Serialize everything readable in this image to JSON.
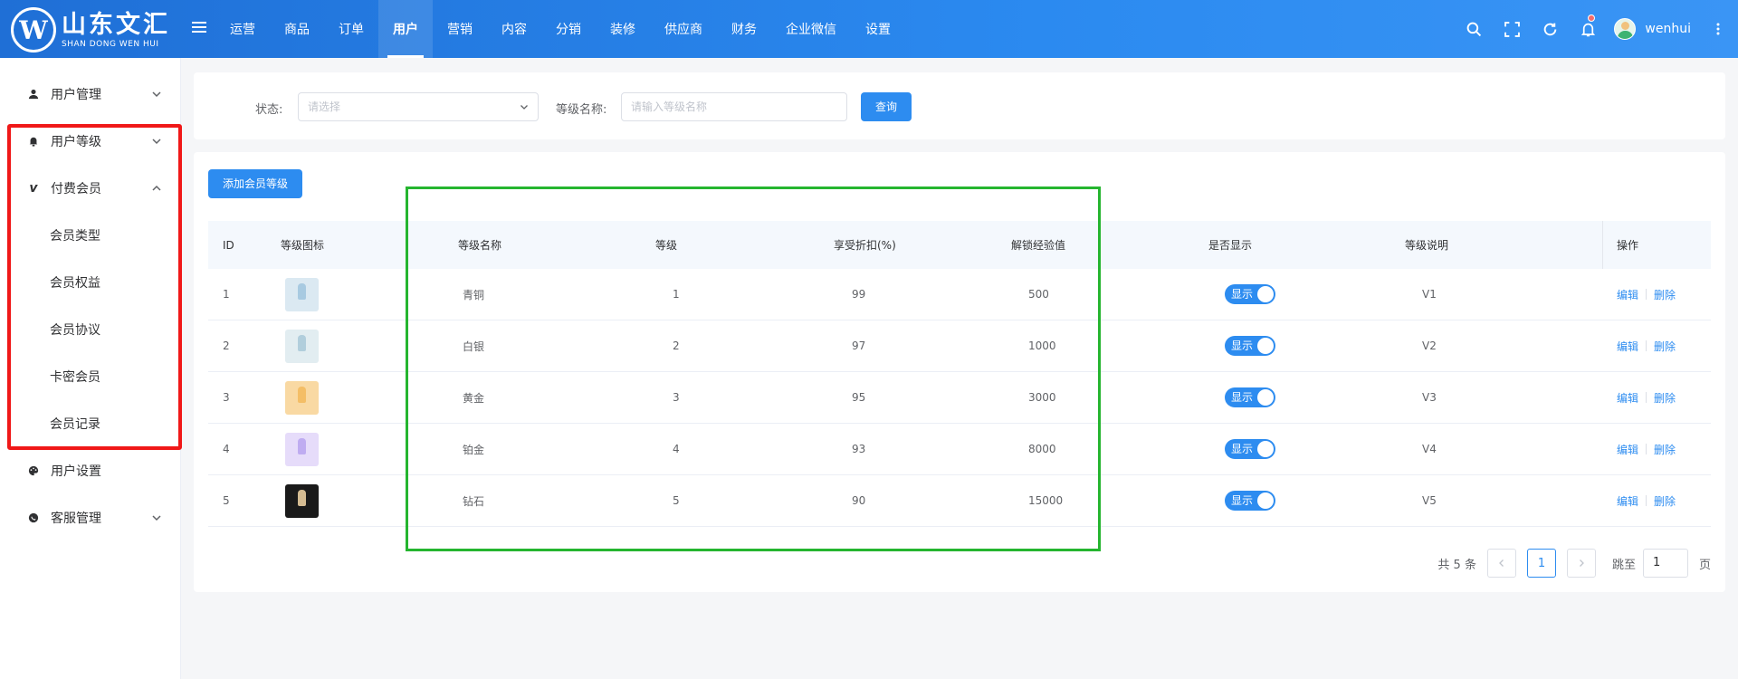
{
  "header": {
    "logo_cn": "山东文汇",
    "logo_en": "SHAN DONG WEN HUI",
    "logo_mark": "W",
    "nav": [
      {
        "label": "运营"
      },
      {
        "label": "商品"
      },
      {
        "label": "订单"
      },
      {
        "label": "用户",
        "active": true
      },
      {
        "label": "营销"
      },
      {
        "label": "内容"
      },
      {
        "label": "分销"
      },
      {
        "label": "装修"
      },
      {
        "label": "供应商"
      },
      {
        "label": "财务"
      },
      {
        "label": "企业微信"
      },
      {
        "label": "设置"
      }
    ],
    "icons": [
      "search-icon",
      "fullscreen-icon",
      "refresh-icon",
      "bell-icon",
      "more-icon"
    ],
    "username": "wenhui"
  },
  "sidebar": {
    "items": [
      {
        "label": "用户管理",
        "icon": "user-icon"
      },
      {
        "label": "用户等级",
        "icon": "bell-icon"
      },
      {
        "label": "付费会员",
        "icon": "vimeo-icon",
        "expanded": true
      },
      {
        "label": "用户设置",
        "icon": "palette-icon"
      },
      {
        "label": "客服管理",
        "icon": "chat-icon"
      }
    ],
    "sub_items": [
      {
        "label": "会员类型"
      },
      {
        "label": "会员权益"
      },
      {
        "label": "会员协议"
      },
      {
        "label": "卡密会员"
      },
      {
        "label": "会员记录"
      }
    ]
  },
  "filter": {
    "status_label": "状态:",
    "status_placeholder": "请选择",
    "level_label": "等级名称:",
    "level_placeholder": "请输入等级名称",
    "query_button": "查询"
  },
  "table": {
    "add_button": "添加会员等级",
    "columns": [
      "ID",
      "等级图标",
      "等级名称",
      "等级",
      "享受折扣(%)",
      "解锁经验值",
      "是否显示",
      "等级说明",
      "操作"
    ],
    "rows": [
      {
        "id": "1",
        "name": "青铜",
        "level": "1",
        "discount": "99",
        "exp": "500",
        "show": "显示",
        "desc": "V1",
        "icon_color": "#dbe9f2",
        "gem_color": "#9fc4de"
      },
      {
        "id": "2",
        "name": "白银",
        "level": "2",
        "discount": "97",
        "exp": "1000",
        "show": "显示",
        "desc": "V2",
        "icon_color": "#e2edf1",
        "gem_color": "#a8c8d8"
      },
      {
        "id": "3",
        "name": "黄金",
        "level": "3",
        "discount": "95",
        "exp": "3000",
        "show": "显示",
        "desc": "V3",
        "icon_color": "#f9d9a3",
        "gem_color": "#f3b85c"
      },
      {
        "id": "4",
        "name": "铂金",
        "level": "4",
        "discount": "93",
        "exp": "8000",
        "show": "显示",
        "desc": "V4",
        "icon_color": "#e6dcfa",
        "gem_color": "#b7a3ef"
      },
      {
        "id": "5",
        "name": "钻石",
        "level": "5",
        "discount": "90",
        "exp": "15000",
        "show": "显示",
        "desc": "V5",
        "icon_color": "#1a1a1a",
        "gem_color": "#f7d9a8"
      }
    ],
    "edit_label": "编辑",
    "delete_label": "删除"
  },
  "pagination": {
    "total_text": "共 5 条",
    "current_page": "1",
    "jump_label": "跳至",
    "jump_value": "1",
    "page_suffix": "页"
  },
  "colors": {
    "accent": "#2d8cf0",
    "highlight_red": "#f01818",
    "highlight_green": "#25b52f"
  }
}
